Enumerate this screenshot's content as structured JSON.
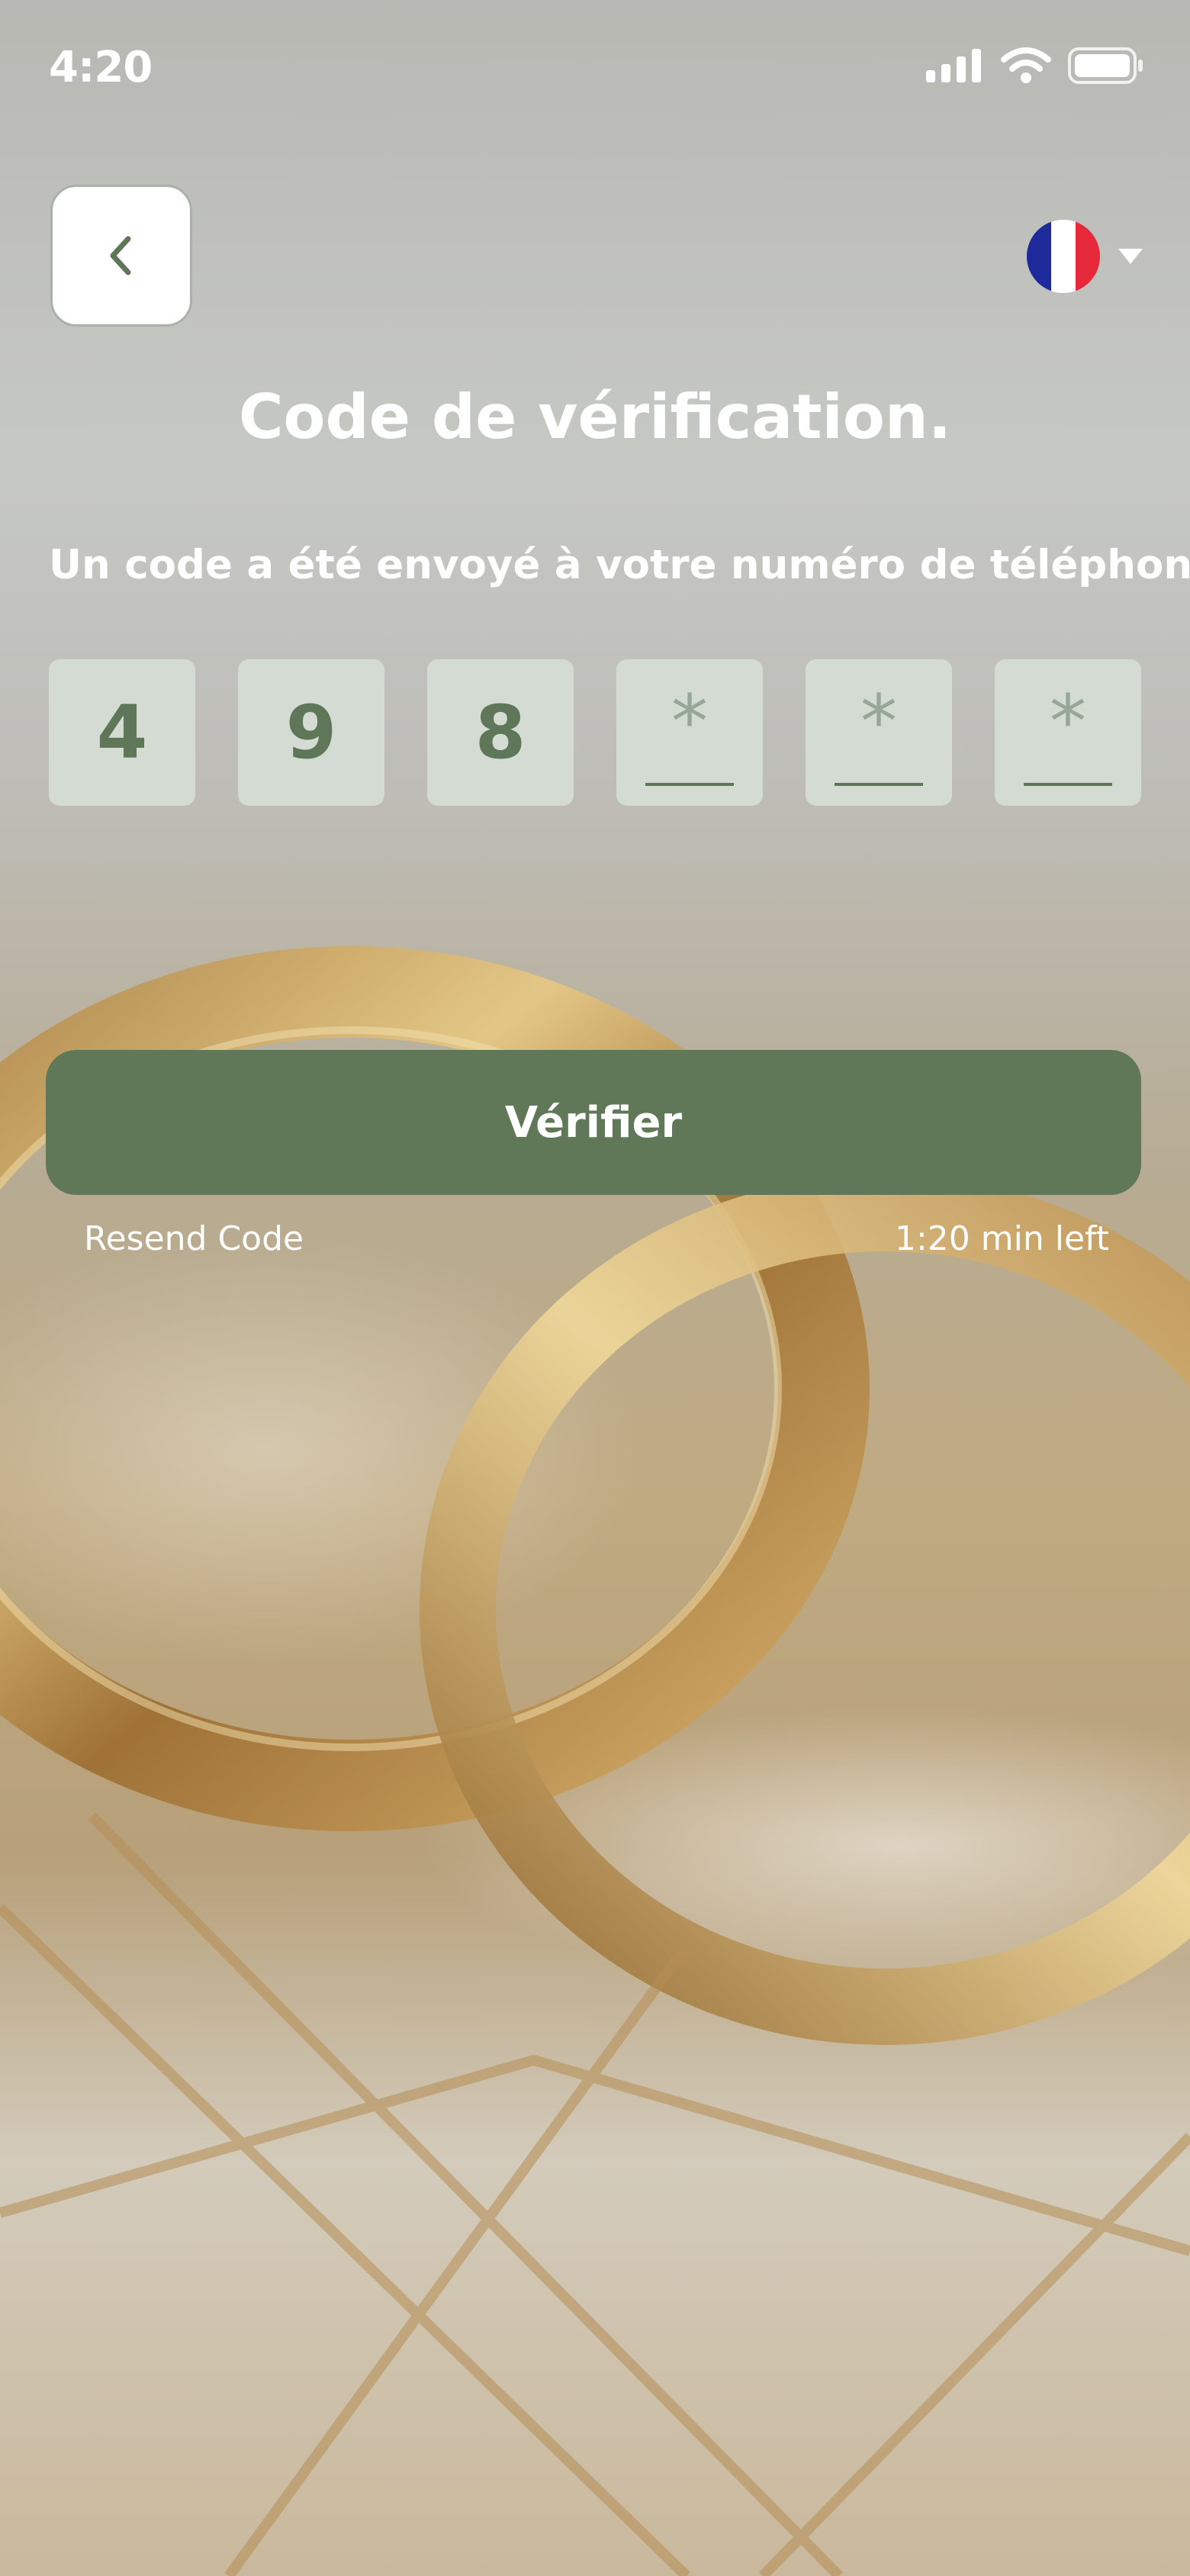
{
  "status_bar": {
    "time": "4:20"
  },
  "header": {
    "back_icon": "chevron-left-icon",
    "language": {
      "flag": "france-flag",
      "dropdown_icon": "caret-down-icon"
    }
  },
  "title": "Code de vérification.",
  "subtitle": "Un code a été envoyé à votre numéro de téléphone.",
  "otp": {
    "digits": [
      "4",
      "9",
      "8",
      "",
      "",
      ""
    ],
    "placeholder": "*"
  },
  "verify_button": {
    "label": "Vérifier"
  },
  "resend_label": "Resend Code",
  "timer_label": "1:20 min left",
  "colors": {
    "accent": "#607857",
    "otp_box": "#d3dbd2",
    "otp_text": "#5f7659",
    "placeholder": "#96a797"
  }
}
